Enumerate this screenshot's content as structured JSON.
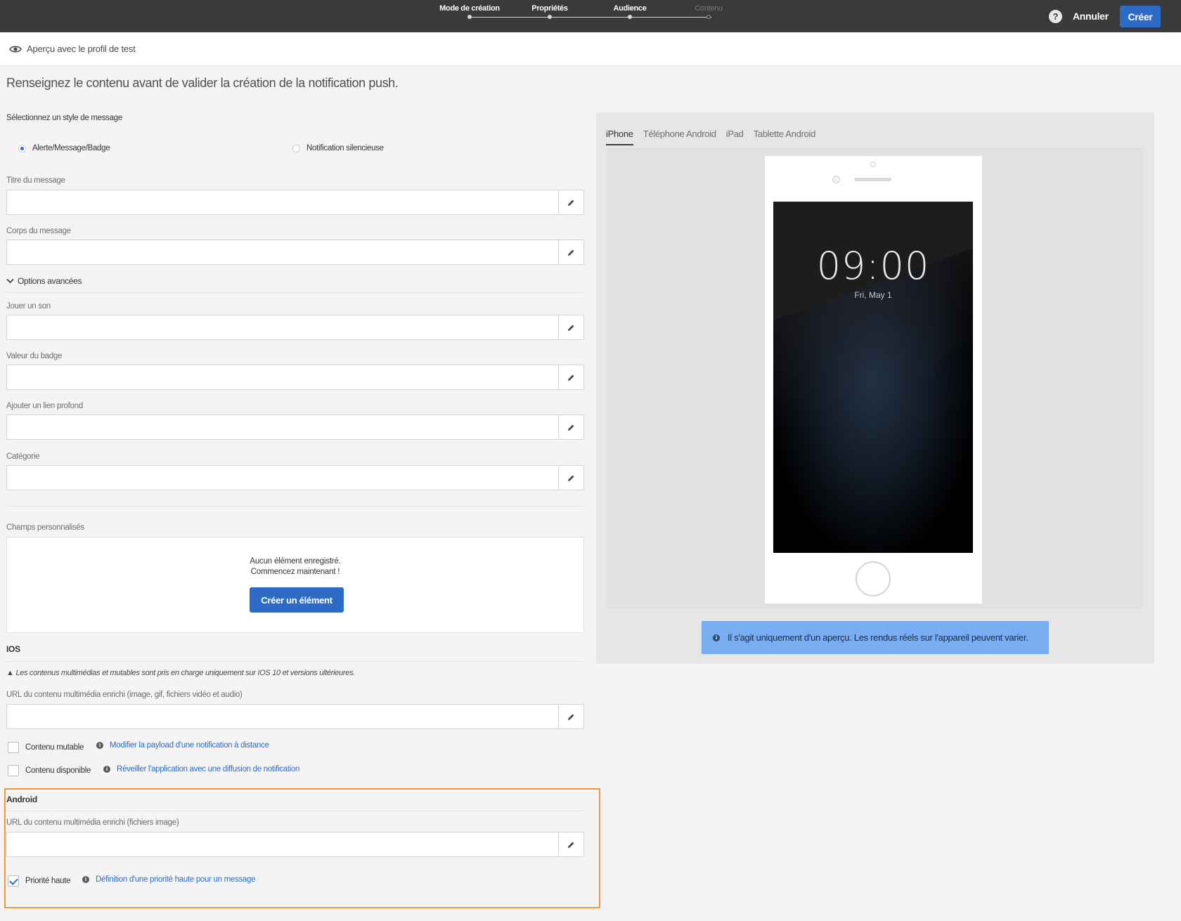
{
  "header": {
    "steps": [
      {
        "label": "Mode de création",
        "state": "done"
      },
      {
        "label": "Propriétés",
        "state": "done"
      },
      {
        "label": "Audience",
        "state": "done"
      },
      {
        "label": "Contenu",
        "state": "current"
      }
    ],
    "help_icon": "?",
    "cancel_label": "Annuler",
    "create_label": "Créer"
  },
  "preview_bar": {
    "icon": "eye-icon",
    "label": "Aperçu avec le profil de test"
  },
  "intro": "Renseignez le contenu avant de valider la création de la notification push.",
  "message_style": {
    "label": "Sélectionnez un style de message",
    "options": [
      {
        "label": "Alerte/Message/Badge",
        "selected": true
      },
      {
        "label": "Notification silencieuse",
        "selected": false
      }
    ]
  },
  "fields": {
    "title": {
      "label": "Titre du message",
      "value": ""
    },
    "body": {
      "label": "Corps du message",
      "value": ""
    },
    "sound": {
      "label": "Jouer un son",
      "value": ""
    },
    "badge": {
      "label": "Valeur du badge",
      "value": ""
    },
    "deeplink": {
      "label": "Ajouter un lien profond",
      "value": ""
    },
    "category": {
      "label": "Catégorie",
      "value": ""
    }
  },
  "advanced_options_label": "Options avancées",
  "custom_fields": {
    "label": "Champs personnalisés",
    "empty_line1": "Aucun élément enregistré.",
    "empty_line2": "Commencez maintenant !",
    "create_button": "Créer un élément"
  },
  "ios": {
    "section": "IOS",
    "note": "Les contenus multimédias et mutables sont pris en charge uniquement sur IOS 10 et versions ultérieures.",
    "media_label": "URL du contenu multimédia enrichi (image, gif, fichiers vidéo et audio)",
    "media_value": "",
    "mutable_label": "Contenu mutable",
    "mutable_checked": false,
    "mutable_link": "Modifier la payload d'une notification à distance",
    "available_label": "Contenu disponible",
    "available_checked": false,
    "available_link": "Réveiller l'application avec une diffusion de notification"
  },
  "android": {
    "section": "Android",
    "media_label": "URL du contenu multimédia enrichi (fichiers image)",
    "media_value": "",
    "priority_label": "Priorité haute",
    "priority_checked": true,
    "priority_link": "Définition d'une priorité haute pour un message"
  },
  "preview": {
    "tabs": [
      {
        "label": "iPhone",
        "active": true
      },
      {
        "label": "Téléphone Android",
        "active": false
      },
      {
        "label": "iPad",
        "active": false
      },
      {
        "label": "Tablette Android",
        "active": false
      }
    ],
    "time": "09:00",
    "date": "Fri, May 1",
    "disclaimer": "Il s'agit uniquement d'un aperçu. Les rendus réels sur l'appareil peuvent varier."
  },
  "colors": {
    "accent": "#2d6bc8",
    "topbar": "#3a3a3a",
    "highlight": "#f0933e",
    "banner": "#78adf2"
  }
}
